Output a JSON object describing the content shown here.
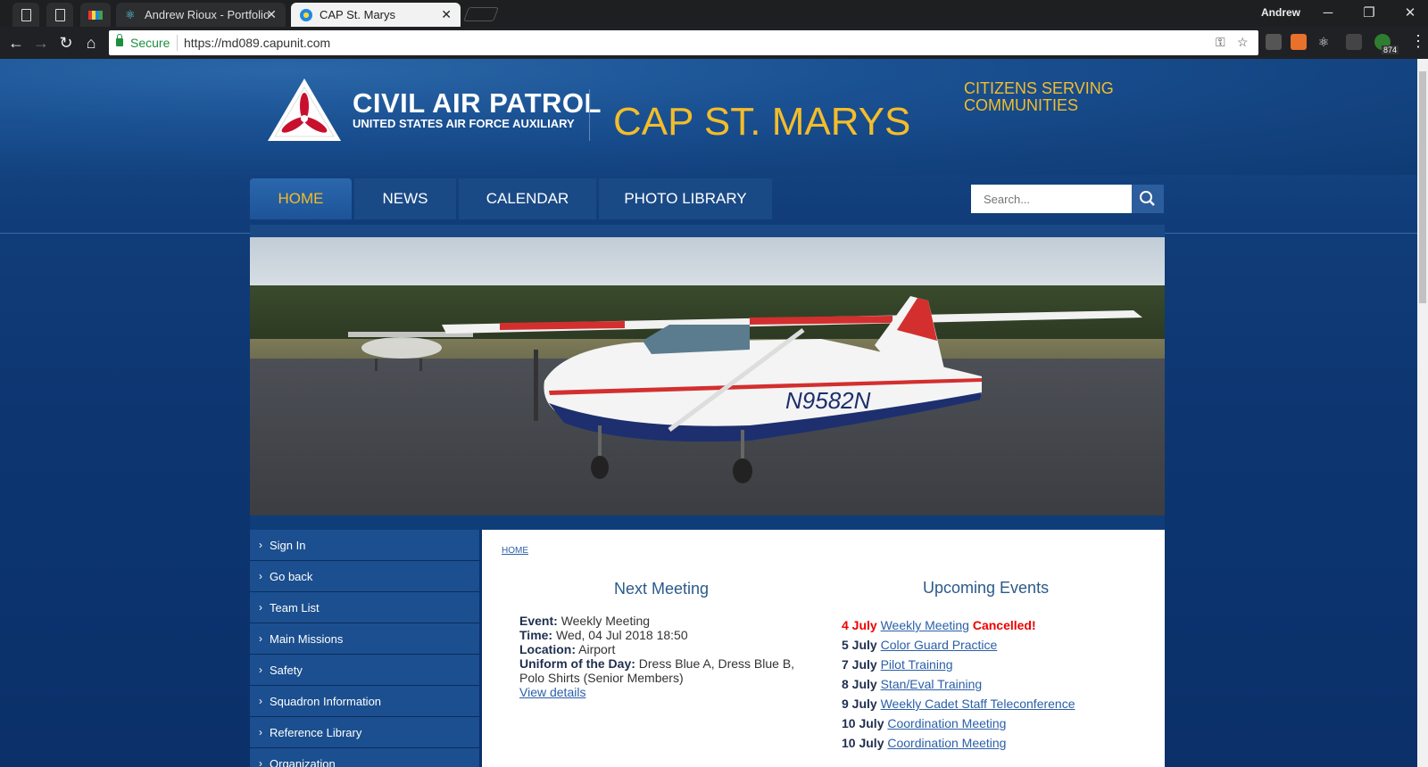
{
  "browser": {
    "tabs": [
      {
        "title": "",
        "icon": "document-icon"
      },
      {
        "title": "",
        "icon": "document-icon"
      },
      {
        "title": "",
        "icon": "colorful-app-icon"
      },
      {
        "title": "Andrew Rioux - Portfolio",
        "icon": "react-atom-icon"
      },
      {
        "title": "CAP St. Marys",
        "icon": "globe-icon",
        "active": true
      }
    ],
    "profile_name": "Andrew",
    "secure_label": "Secure",
    "url": "https://md089.capunit.com",
    "extension_badge": "874"
  },
  "header": {
    "logo_title": "CIVIL AIR PATROL",
    "logo_subtitle": "UNITED STATES AIR FORCE AUXILIARY",
    "site_title": "CAP ST. MARYS",
    "tagline_line1": "CITIZENS SERVING",
    "tagline_line2": "COMMUNITIES",
    "accent_color": "#f3bd2a"
  },
  "nav": {
    "items": [
      "HOME",
      "NEWS",
      "CALENDAR",
      "PHOTO LIBRARY"
    ],
    "active": "HOME"
  },
  "search": {
    "placeholder": "Search..."
  },
  "sidebar": {
    "items": [
      "Sign In",
      "Go back",
      "Team List",
      "Main Missions",
      "Safety",
      "Squadron Information",
      "Reference Library",
      "Organization"
    ]
  },
  "content": {
    "breadcrumb": "HOME",
    "next_meeting": {
      "heading": "Next Meeting",
      "event_label": "Event:",
      "event_value": "Weekly Meeting",
      "time_label": "Time:",
      "time_value": "Wed, 04 Jul 2018 18:50",
      "location_label": "Location:",
      "location_value": "Airport",
      "uniform_label": "Uniform of the Day:",
      "uniform_value": "Dress Blue A, Dress Blue B, Polo Shirts (Senior Members)",
      "details_link": "View details"
    },
    "upcoming": {
      "heading": "Upcoming Events",
      "events": [
        {
          "date": "4 July",
          "title": "Weekly Meeting",
          "note": "Cancelled!"
        },
        {
          "date": "5 July",
          "title": "Color Guard Practice",
          "note": ""
        },
        {
          "date": "7 July",
          "title": "Pilot Training",
          "note": ""
        },
        {
          "date": "8 July",
          "title": "Stan/Eval Training",
          "note": ""
        },
        {
          "date": "9 July",
          "title": "Weekly Cadet Staff Teleconference",
          "note": ""
        },
        {
          "date": "10 July",
          "title": "Coordination Meeting",
          "note": ""
        },
        {
          "date": "10 July",
          "title": "Coordination Meeting",
          "note": ""
        }
      ]
    }
  },
  "hero": {
    "aircraft_tail_number": "N9582N"
  }
}
